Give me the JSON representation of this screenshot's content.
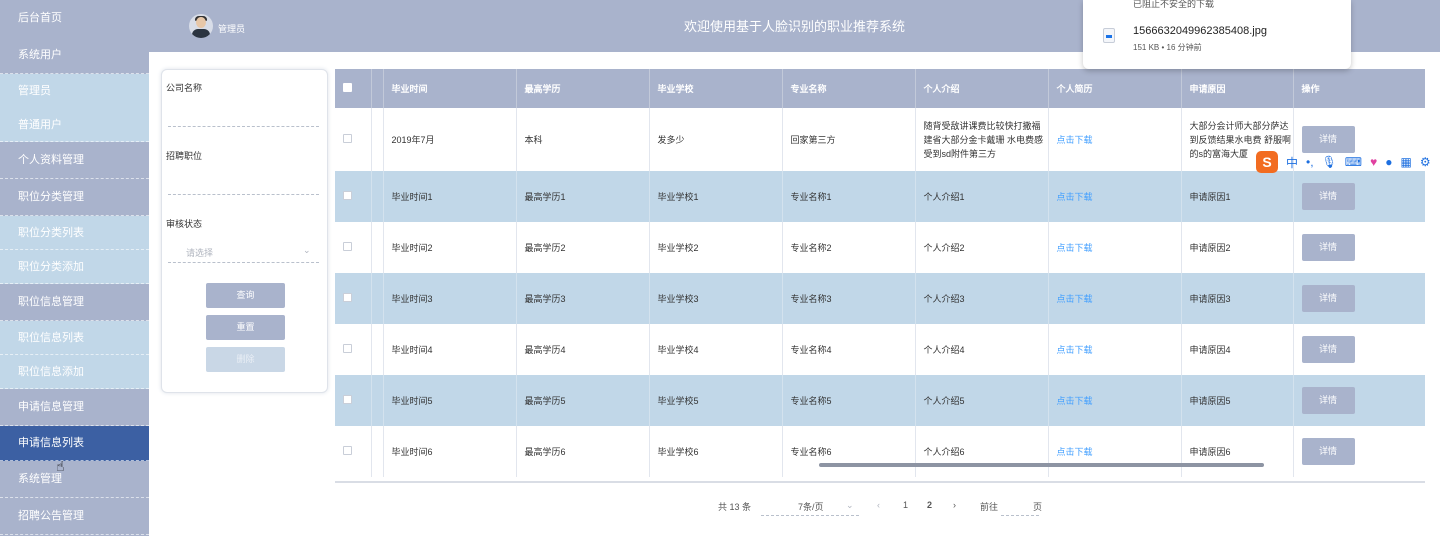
{
  "sidebar": {
    "items": [
      {
        "label": "后台首页",
        "kind": "header"
      },
      {
        "label": "系统用户",
        "kind": "header"
      },
      {
        "label": "管理员",
        "kind": "sub"
      },
      {
        "label": "普通用户",
        "kind": "sub"
      },
      {
        "label": "个人资料管理",
        "kind": "header"
      },
      {
        "label": "职位分类管理",
        "kind": "header"
      },
      {
        "label": "职位分类列表",
        "kind": "sub"
      },
      {
        "label": "职位分类添加",
        "kind": "sub"
      },
      {
        "label": "职位信息管理",
        "kind": "header"
      },
      {
        "label": "职位信息列表",
        "kind": "sub"
      },
      {
        "label": "职位信息添加",
        "kind": "sub"
      },
      {
        "label": "申请信息管理",
        "kind": "header"
      },
      {
        "label": "申请信息列表",
        "kind": "active"
      },
      {
        "label": "系统管理",
        "kind": "header"
      },
      {
        "label": "招聘公告管理",
        "kind": "header"
      }
    ]
  },
  "header": {
    "admin_name": "管理员",
    "title": "欢迎使用基于人脸识别的职业推荐系统"
  },
  "search": {
    "company_label": "公司名称",
    "position_label": "招聘职位",
    "status_label": "审核状态",
    "status_placeholder": "请选择",
    "query_button": "查询",
    "reset_button": "重置",
    "delete_button": "删除"
  },
  "table": {
    "columns": [
      "毕业时间",
      "最高学历",
      "毕业学校",
      "专业名称",
      "个人介绍",
      "个人简历",
      "申请原因",
      "操作"
    ],
    "rows": [
      {
        "time": "2019年7月",
        "degree": "本科",
        "school": "发多少",
        "major": "回家第三方",
        "intro": "随背受敌讲课费比较快打撒福建省大部分金卡戴珊 水电费感受到sd附件第三方",
        "resume": "点击下载",
        "reason": "大部分会计师大部分萨达到反馈结果水电费 舒服啊的s的富海大厦",
        "action": "详情"
      },
      {
        "time": "毕业时间1",
        "degree": "最高学历1",
        "school": "毕业学校1",
        "major": "专业名称1",
        "intro": "个人介绍1",
        "resume": "点击下载",
        "reason": "申请原因1",
        "action": "详情"
      },
      {
        "time": "毕业时间2",
        "degree": "最高学历2",
        "school": "毕业学校2",
        "major": "专业名称2",
        "intro": "个人介绍2",
        "resume": "点击下载",
        "reason": "申请原因2",
        "action": "详情"
      },
      {
        "time": "毕业时间3",
        "degree": "最高学历3",
        "school": "毕业学校3",
        "major": "专业名称3",
        "intro": "个人介绍3",
        "resume": "点击下载",
        "reason": "申请原因3",
        "action": "详情"
      },
      {
        "time": "毕业时间4",
        "degree": "最高学历4",
        "school": "毕业学校4",
        "major": "专业名称4",
        "intro": "个人介绍4",
        "resume": "点击下载",
        "reason": "申请原因4",
        "action": "详情"
      },
      {
        "time": "毕业时间5",
        "degree": "最高学历5",
        "school": "毕业学校5",
        "major": "专业名称5",
        "intro": "个人介绍5",
        "resume": "点击下载",
        "reason": "申请原因5",
        "action": "详情"
      },
      {
        "time": "毕业时间6",
        "degree": "最高学历6",
        "school": "毕业学校6",
        "major": "专业名称6",
        "intro": "个人介绍6",
        "resume": "点击下载",
        "reason": "申请原因6",
        "action": "详情"
      }
    ]
  },
  "pagination": {
    "total": "共 13 条",
    "page_size": "7条/页",
    "prev": "‹",
    "pages": [
      "1",
      "2"
    ],
    "current_page": "1",
    "next": "›",
    "goto_label": "前往",
    "page_unit": "页"
  },
  "download_popup": {
    "blocked_text": "已阻止不安全的下载",
    "filename": "1566632049962385408.jpg",
    "meta": "151 KB • 16 分钟前"
  },
  "ime": {
    "logo": "S",
    "lang": "中",
    "punct": "•,",
    "icons": [
      "microphone-icon",
      "keyboard-icon",
      "skin-icon",
      "robot-icon",
      "apps-icon",
      "settings-icon"
    ]
  },
  "colors": {
    "sidebar_bg": "#a9b3cc",
    "sidebar_sub_bg": "#c1d7e8",
    "sidebar_active": "#3c60a3",
    "table_header": "#a9b3cc",
    "row_alt": "#c1d7e8",
    "link": "#409eff"
  }
}
